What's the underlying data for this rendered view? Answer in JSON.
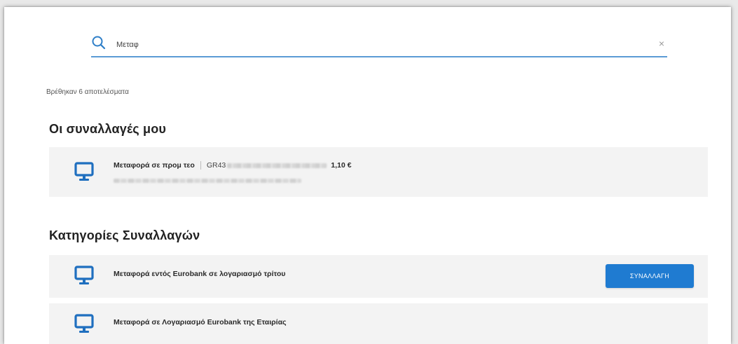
{
  "search": {
    "value": "Μεταφ",
    "clear_symbol": "×"
  },
  "results": {
    "count_text": "Βρέθηκαν 6 αποτελέσματα"
  },
  "sections": {
    "my_transactions_title": "Οι συναλλαγές μου",
    "categories_title": "Κατηγορίες Συναλλαγών"
  },
  "transaction": {
    "title": "Μεταφορά σε προμ τεο",
    "iban_prefix": "GR43",
    "amount": "1,10 €"
  },
  "categories": [
    {
      "label": "Μεταφορά εντός Eurobank σε λογαριασμό τρίτου",
      "button_label": "ΣΥΝΑΛΛΑΓΗ"
    },
    {
      "label": "Μεταφορά σε Λογαριασμό Eurobank της Εταιρίας"
    }
  ],
  "icons": {
    "search": "search-icon",
    "row": "monitor-icon",
    "clear": "close-icon"
  },
  "colors": {
    "accent": "#1f7bd1",
    "search_underline": "#5b9bd5",
    "row_background": "#f3f3f3"
  }
}
